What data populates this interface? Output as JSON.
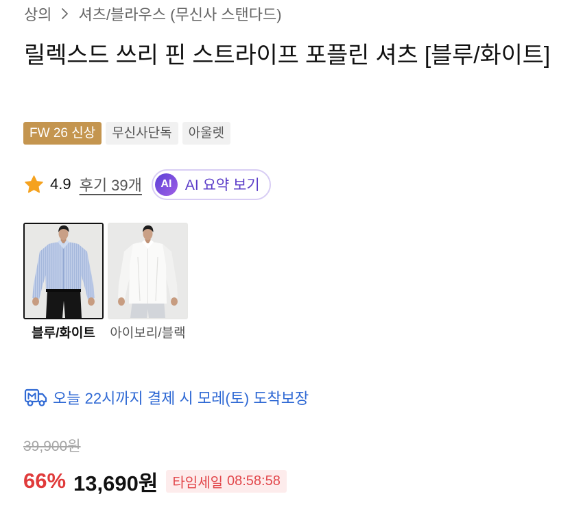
{
  "breadcrumb": {
    "category": "상의",
    "separator_icon": "chevron-right-icon",
    "subcategory": "셔츠/블라우스 (무신사 스탠다드)"
  },
  "product": {
    "title": "릴렉스드 쓰리 핀 스트라이프 포플린 셔츠 [블루/화이트]",
    "badges": [
      {
        "label": "FW 26 신상",
        "highlight": true
      },
      {
        "label": "무신사단독",
        "highlight": false
      },
      {
        "label": "아울렛",
        "highlight": false
      }
    ]
  },
  "rating": {
    "icon": "star-icon",
    "score": "4.9",
    "reviews_label": "후기 39개",
    "ai_summary": {
      "badge": "AI",
      "label": "AI 요약 보기"
    }
  },
  "color_options": [
    {
      "label": "블루/화이트",
      "selected": true
    },
    {
      "label": "아이보리/블랙",
      "selected": false
    }
  ],
  "delivery": {
    "icon": "delivery-truck-icon",
    "text": "오늘 22시까지 결제 시 모레(토) 도착보장"
  },
  "price": {
    "original": "39,900원",
    "discount_rate": "66%",
    "sale_price": "13,690원",
    "timesale_label": "타임세일",
    "timesale_countdown": "08:58:58"
  },
  "theme": {
    "season_badge": "#C4954F",
    "ai_accent": "#5A3BC8",
    "delivery_accent": "#2F69D4",
    "discount_accent": "#E03B3B",
    "timesale_background": "#FDECEC",
    "timesale_text": "#E2464A",
    "star": "#F5A21F"
  }
}
